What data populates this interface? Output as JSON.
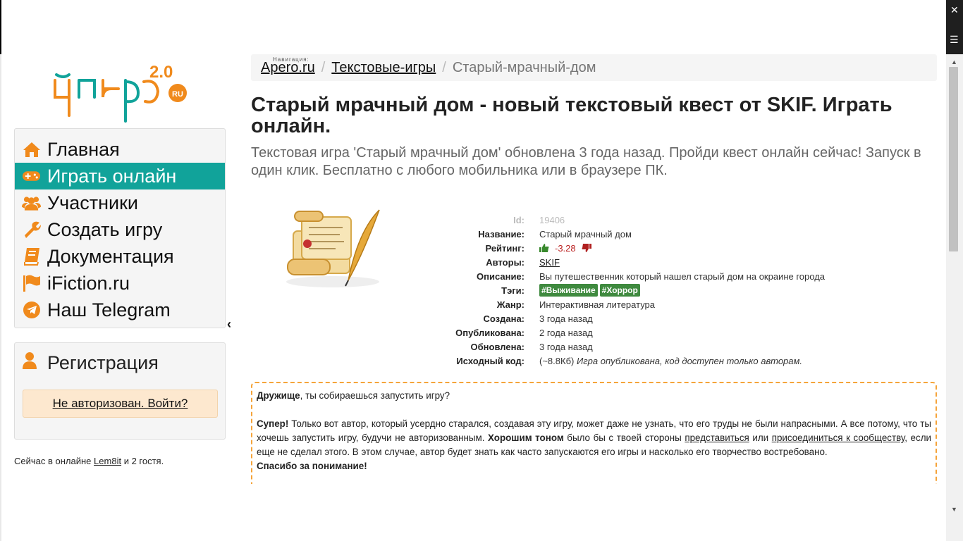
{
  "logo": {
    "text": "Йперо",
    "version": "2.0",
    "tld": "RU"
  },
  "menu": [
    {
      "label": "Главная",
      "icon": "home-icon"
    },
    {
      "label": "Играть онлайн",
      "icon": "gamepad-icon",
      "active": true
    },
    {
      "label": "Участники",
      "icon": "users-icon"
    },
    {
      "label": "Создать игру",
      "icon": "wrench-icon"
    },
    {
      "label": "Документация",
      "icon": "book-icon"
    },
    {
      "label": "iFiction.ru",
      "icon": "flag-icon"
    },
    {
      "label": "Наш Telegram",
      "icon": "telegram-icon"
    }
  ],
  "collapse_glyph": "‹",
  "registration": {
    "title": "Регистрация",
    "login": "Не авторизован. Войти?"
  },
  "online": {
    "prefix": "Сейчас в онлайне",
    "user": "Lem8it",
    "suffix": "и 2 гостя."
  },
  "breadcrumb": {
    "label": "Навигация:",
    "items": [
      "Apero.ru",
      "Текстовые-игры",
      "Старый-мрачный-дом"
    ]
  },
  "title": "Старый мрачный дом - новый текстовый квест от SKIF. Играть онлайн.",
  "lead": "Текстовая игра 'Старый мрачный дом' обновлена 3 года назад. Пройди квест онлайн сейчас! Запуск в один клик. Бесплатно с любого мобильника или в браузере ПК.",
  "info": {
    "id_label": "Id:",
    "id": "19406",
    "name_label": "Название:",
    "name": "Старый мрачный дом",
    "rating_label": "Рейтинг:",
    "rating": "-3.28",
    "authors_label": "Авторы:",
    "authors": "SKIF",
    "desc_label": "Описание:",
    "desc": "Вы путешественник который нашел старый дом на окраине города",
    "tags_label": "Тэги:",
    "tags": [
      "#Выживание",
      "#Хоррор"
    ],
    "genre_label": "Жанр:",
    "genre": "Интерактивная литература",
    "created_label": "Создана:",
    "created": "3 года назад",
    "published_label": "Опубликована:",
    "published": "2 года назад",
    "updated_label": "Обновлена:",
    "updated": "3 года назад",
    "source_label": "Исходный код:",
    "source_size": "(~8.8Кб)",
    "source_note": "Игра опубликована, код доступен только авторам."
  },
  "notice": {
    "l1_bold": "Дружище",
    "l1_rest": ", ты собираешься запустить игру?",
    "p2_bold": "Супер!",
    "p2_a": " Только вот автор, который усердно старался, создавая эту игру, может даже не узнать, что его труды не были напрасными. А все потому, что ты хочешь запустить игру, будучи не авторизованным. ",
    "p2_bold2": "Хорошим тоном",
    "p2_b": " было бы с твоей стороны ",
    "link1": "представиться",
    "p2_c": " или ",
    "link2": "присоединиться к сообществу",
    "p2_d": ", если еще не сделал этого. В этом случае, автор будет знать как часто запускаются его игры и насколько его творчество востребовано.",
    "thanks": "Спасибо за понимание!"
  },
  "colors": {
    "accent": "#11a39a",
    "orange": "#f08a1c",
    "tag": "#3f8a3f"
  }
}
